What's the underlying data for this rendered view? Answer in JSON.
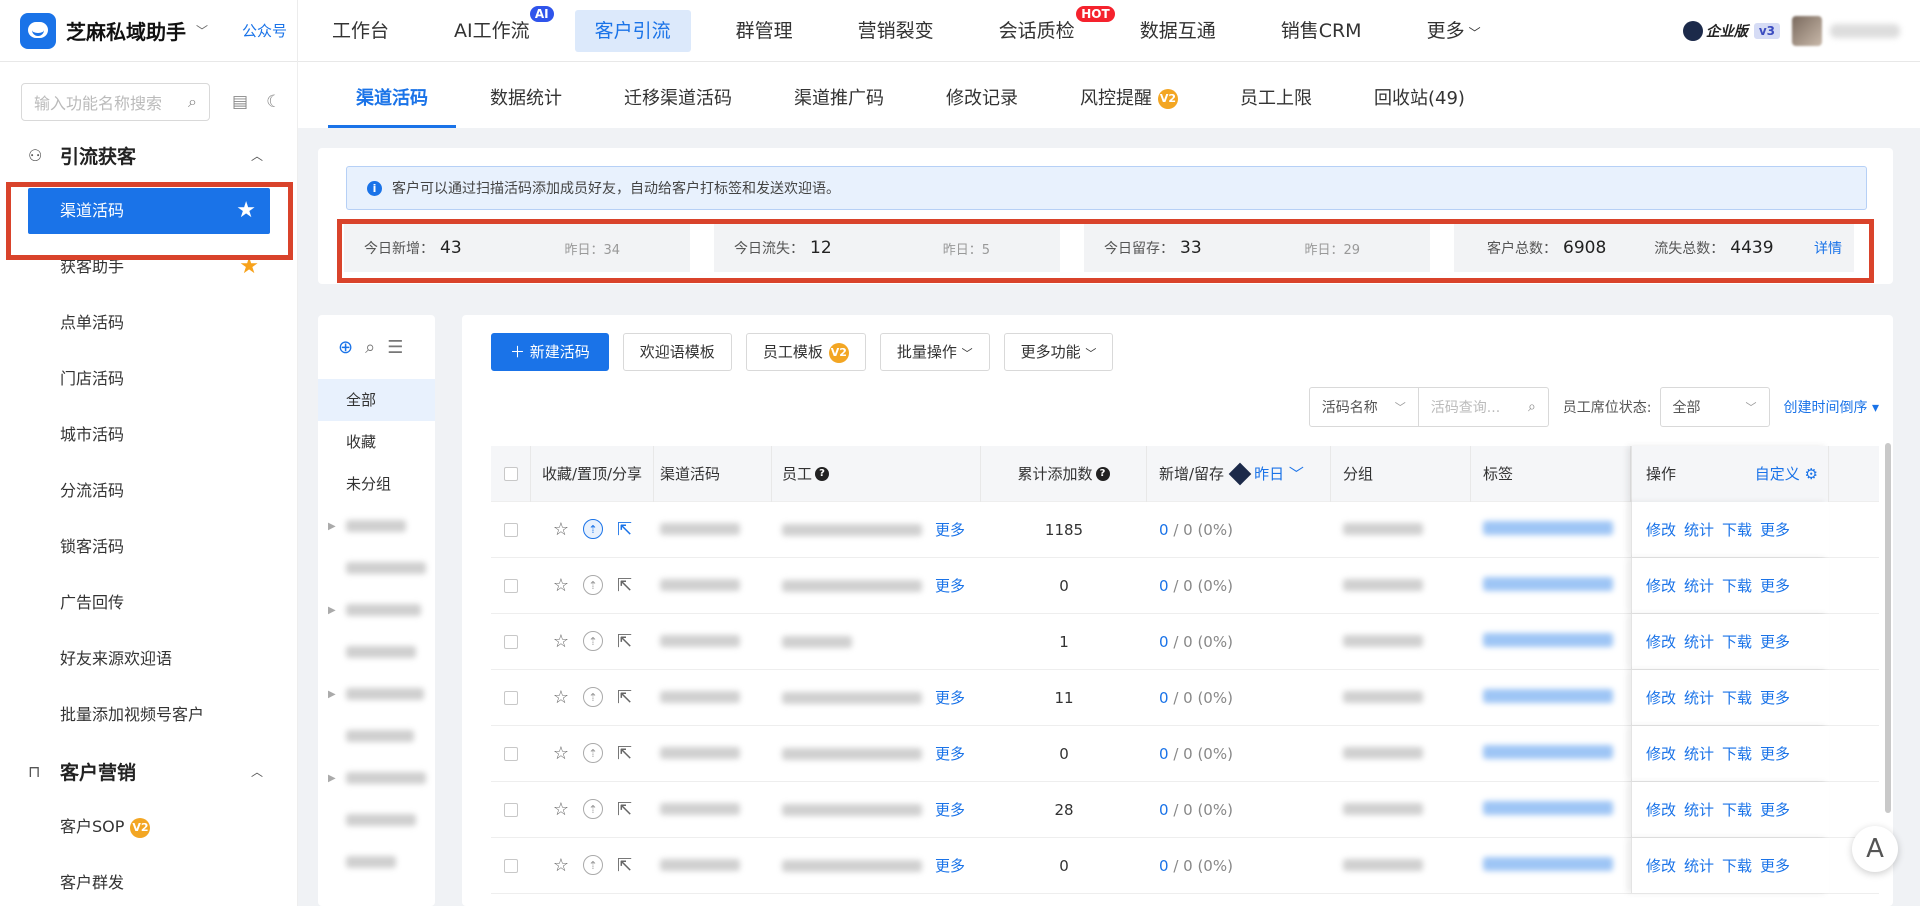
{
  "brand": {
    "name": "芝麻私域助手",
    "link": "公众号"
  },
  "topnav": [
    {
      "label": "工作台"
    },
    {
      "label": "AI工作流",
      "tag": "AI"
    },
    {
      "label": "客户引流",
      "active": true
    },
    {
      "label": "群管理"
    },
    {
      "label": "营销裂变"
    },
    {
      "label": "会话质检",
      "tag": "HOT"
    },
    {
      "label": "数据互通"
    },
    {
      "label": "销售CRM"
    },
    {
      "label": "更多"
    }
  ],
  "account": {
    "edition": "企业版",
    "version": "v3"
  },
  "sidebar": {
    "search_placeholder": "输入功能名称搜索",
    "group1": "引流获客",
    "items1": [
      "渠道活码",
      "获客助手",
      "点单活码",
      "门店活码",
      "城市活码",
      "分流活码",
      "锁客活码",
      "广告回传",
      "好友来源欢迎语",
      "批量添加视频号客户"
    ],
    "group2": "客户营销",
    "items2": [
      "客户SOP",
      "客户群发"
    ],
    "v2": "V2"
  },
  "subtabs": [
    "渠道活码",
    "数据统计",
    "迁移渠道活码",
    "渠道推广码",
    "修改记录",
    "风控提醒",
    "员工上限",
    "回收站(49)"
  ],
  "notice": "客户可以通过扫描活码添加成员好友，自动给客户打标签和发送欢迎语。",
  "stats": {
    "today_new_label": "今日新增：",
    "today_new": "43",
    "yest_new": "昨日：34",
    "today_lost_label": "今日流失：",
    "today_lost": "12",
    "yest_lost": "昨日：5",
    "today_keep_label": "今日留存：",
    "today_keep": "33",
    "yest_keep": "昨日：29",
    "total_label": "客户总数：",
    "total": "6908",
    "lost_total_label": "流失总数：",
    "lost_total": "4439",
    "detail": "详情"
  },
  "tree": {
    "items": [
      "全部",
      "收藏",
      "未分组"
    ]
  },
  "toolbar": {
    "new": "新建活码",
    "welcome": "欢迎语模板",
    "staff": "员工模板",
    "batch": "批量操作",
    "morefn": "更多功能"
  },
  "filter": {
    "field": "活码名称",
    "placeholder": "活码查询...",
    "seat_label": "员工席位状态:",
    "seat_value": "全部",
    "sort": "创建时间倒序"
  },
  "table": {
    "headers": {
      "fav": "收藏/置顶/分享",
      "code": "渠道活码",
      "staff": "员工",
      "total": "累计添加数",
      "newkeep": "新增/留存",
      "day": "昨日",
      "group": "分组",
      "tags": "标签",
      "ops": "操作",
      "custom": "自定义"
    },
    "more": "更多",
    "rows": [
      {
        "total": "1185",
        "nk_new": "0",
        "nk_rest": " / 0 (0%)",
        "pinned": true,
        "more": true
      },
      {
        "total": "0",
        "nk_new": "0",
        "nk_rest": " / 0 (0%)",
        "pinned": false,
        "more": true
      },
      {
        "total": "1",
        "nk_new": "0",
        "nk_rest": " / 0 (0%)",
        "pinned": false,
        "more": false
      },
      {
        "total": "11",
        "nk_new": "0",
        "nk_rest": " / 0 (0%)",
        "pinned": false,
        "more": true
      },
      {
        "total": "0",
        "nk_new": "0",
        "nk_rest": " / 0 (0%)",
        "pinned": false,
        "more": true
      },
      {
        "total": "28",
        "nk_new": "0",
        "nk_rest": " / 0 (0%)",
        "pinned": false,
        "more": true
      },
      {
        "total": "0",
        "nk_new": "0",
        "nk_rest": " / 0 (0%)",
        "pinned": false,
        "more": true
      }
    ],
    "ops": [
      "修改",
      "统计",
      "下载",
      "更多"
    ]
  },
  "float_btn": "A"
}
